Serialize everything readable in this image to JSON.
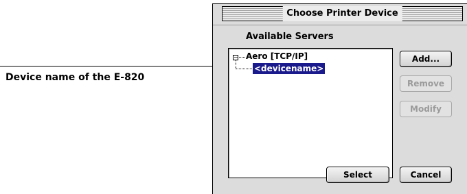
{
  "annotation": {
    "label": "Device name of the E-820"
  },
  "dialog": {
    "title": "Choose Printer Device",
    "section_label": "Available Servers",
    "tree": {
      "toggle_symbol": "−",
      "root": "Aero [TCP/IP]",
      "child": "<devicename>"
    },
    "buttons": {
      "add": "Add...",
      "remove": "Remove",
      "modify": "Modify",
      "select": "Select",
      "cancel": "Cancel"
    }
  }
}
